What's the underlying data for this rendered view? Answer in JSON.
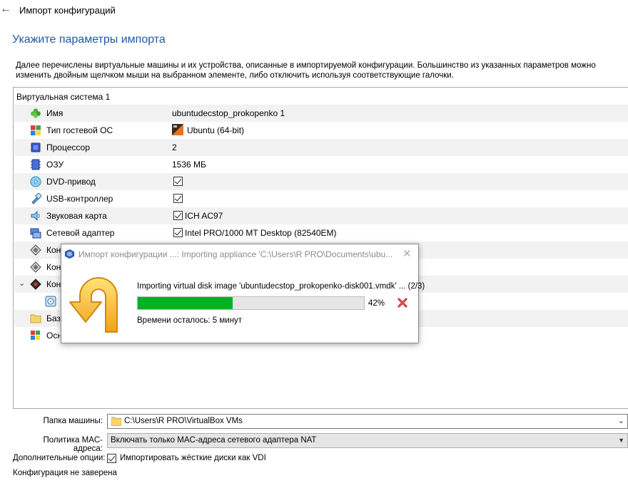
{
  "window": {
    "title": "Импорт конфигураций"
  },
  "page": {
    "heading": "Укажите параметры импорта",
    "description": "Далее перечислены виртуальные машины и их устройства, описанные в импортируемой конфигурации. Большинство из указанных параметров можно изменить двойным щелчком мыши на выбранном элементе, либо отключить используя соответствующие галочки."
  },
  "tree": {
    "header": "Виртуальная система 1",
    "rows": [
      {
        "label": "Имя",
        "value": "ubuntudecstop_prokopenko 1",
        "icon": "name-icon"
      },
      {
        "label": "Тип гостевой ОС",
        "value": "Ubuntu (64-bit)",
        "icon": "os-type-icon"
      },
      {
        "label": "Процессор",
        "value": "2",
        "icon": "cpu-icon"
      },
      {
        "label": "ОЗУ",
        "value": "1536 МБ",
        "icon": "ram-icon"
      },
      {
        "label": "DVD-привод",
        "value": "",
        "icon": "dvd-icon",
        "checked": true
      },
      {
        "label": "USB-контроллер",
        "value": "",
        "icon": "usb-icon",
        "checked": true
      },
      {
        "label": "Звуковая карта",
        "value": "ICH AC97",
        "icon": "audio-icon",
        "checked": true
      },
      {
        "label": "Сетевой адаптер",
        "value": "Intel PRO/1000 MT Desktop (82540EM)",
        "icon": "network-icon",
        "checked": true
      },
      {
        "label": "Кон",
        "value": "",
        "icon": "controller-icon"
      },
      {
        "label": "Кон",
        "value": "",
        "icon": "controller-icon"
      },
      {
        "label": "Кон",
        "value": "",
        "icon": "controller-sata-icon"
      },
      {
        "label": "",
        "value": "",
        "icon": "disk-icon"
      },
      {
        "label": "Базо",
        "value": "",
        "icon": "folder-icon"
      },
      {
        "label": "Осн",
        "value": "",
        "icon": "description-icon"
      }
    ]
  },
  "dialog": {
    "title": "Импорт конфигурации ...: Importing appliance 'C:\\Users\\R PRO\\Documents\\ubu...",
    "message": "Importing virtual disk image 'ubuntudecstop_prokopenko-disk001.vmdk' ... (2/3)",
    "progress_percent": 42,
    "progress_label": "42%",
    "remaining": "Времени осталось: 5 минут",
    "progress_color": "#06b025"
  },
  "options": {
    "machine_folder_label": "Папка машины:",
    "machine_folder_value": "C:\\Users\\R PRO\\VirtualBox VMs",
    "mac_policy_label": "Политика MAC-адреса:",
    "mac_policy_value": "Включать только MAC-адреса сетевого адаптера NAT",
    "extra_options_label": "Дополнительные опции:",
    "import_vdi_label": "Импортировать жёсткие диски как VDI",
    "import_vdi_checked": true,
    "signature_status": "Конфигурация не заверена"
  },
  "colors": {
    "heading": "#1e5aa8",
    "accent": "#06b025"
  }
}
